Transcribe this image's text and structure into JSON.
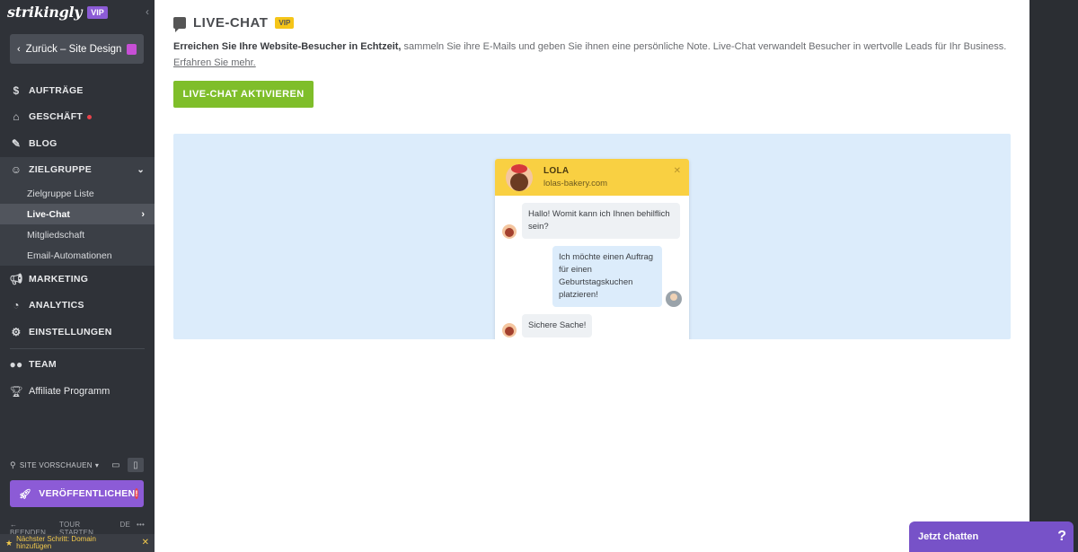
{
  "sidebar": {
    "brand": "strikingly",
    "vip": "VIP",
    "back_label": "Zurück – Site Design",
    "nav": [
      {
        "label": "AUFTRÄGE"
      },
      {
        "label": "GESCHÄFT"
      },
      {
        "label": "BLOG"
      },
      {
        "label": "ZIELGRUPPE"
      },
      {
        "label": "MARKETING"
      },
      {
        "label": "ANALYTICS"
      },
      {
        "label": "EINSTELLUNGEN"
      },
      {
        "label": "TEAM"
      },
      {
        "label": "Affiliate Programm"
      }
    ],
    "sub": [
      {
        "label": "Zielgruppe Liste"
      },
      {
        "label": "Live-Chat"
      },
      {
        "label": "Mitgliedschaft"
      },
      {
        "label": "Email-Automationen"
      }
    ],
    "preview_label": "SITE VORSCHAUEN",
    "publish_label": "VERÖFFENTLICHEN",
    "footer": {
      "quit": "BEENDEN",
      "tour": "TOUR STARTEN",
      "lang": "DE",
      "more": "•••"
    },
    "next_step": "Nächster Schritt: Domain hinzufügen"
  },
  "main": {
    "title": "LIVE-CHAT",
    "vip": "VIP",
    "desc_bold": "Erreichen Sie Ihre Website-Besucher in Echtzeit,",
    "desc_rest": " sammeln Sie ihre E-Mails und geben Sie ihnen eine persönliche Note. Live-Chat verwandelt Besucher in wertvolle Leads für Ihr Business. ",
    "desc_link": "Erfahren Sie mehr.",
    "activate_label": "LIVE-CHAT AKTIVIEREN"
  },
  "widget": {
    "name": "LOLA",
    "site": "lolas-bakery.com",
    "close": "✕",
    "messages": [
      {
        "from": "agent",
        "text": "Hallo! Womit kann ich Ihnen behilflich sein?"
      },
      {
        "from": "guest",
        "text": "Ich möchte einen Auftrag für einen Geburtstagskuchen platzieren!"
      },
      {
        "from": "agent",
        "text": "Sichere Sache!"
      }
    ]
  },
  "chat_button": {
    "label": "Jetzt chatten",
    "help": "?"
  },
  "colors": {
    "sidebar": "#2f3238",
    "accent_purple": "#8c5bd6",
    "green": "#7fbe2a",
    "widget_yellow": "#f9d042",
    "preview_bg": "#dcecfb"
  }
}
